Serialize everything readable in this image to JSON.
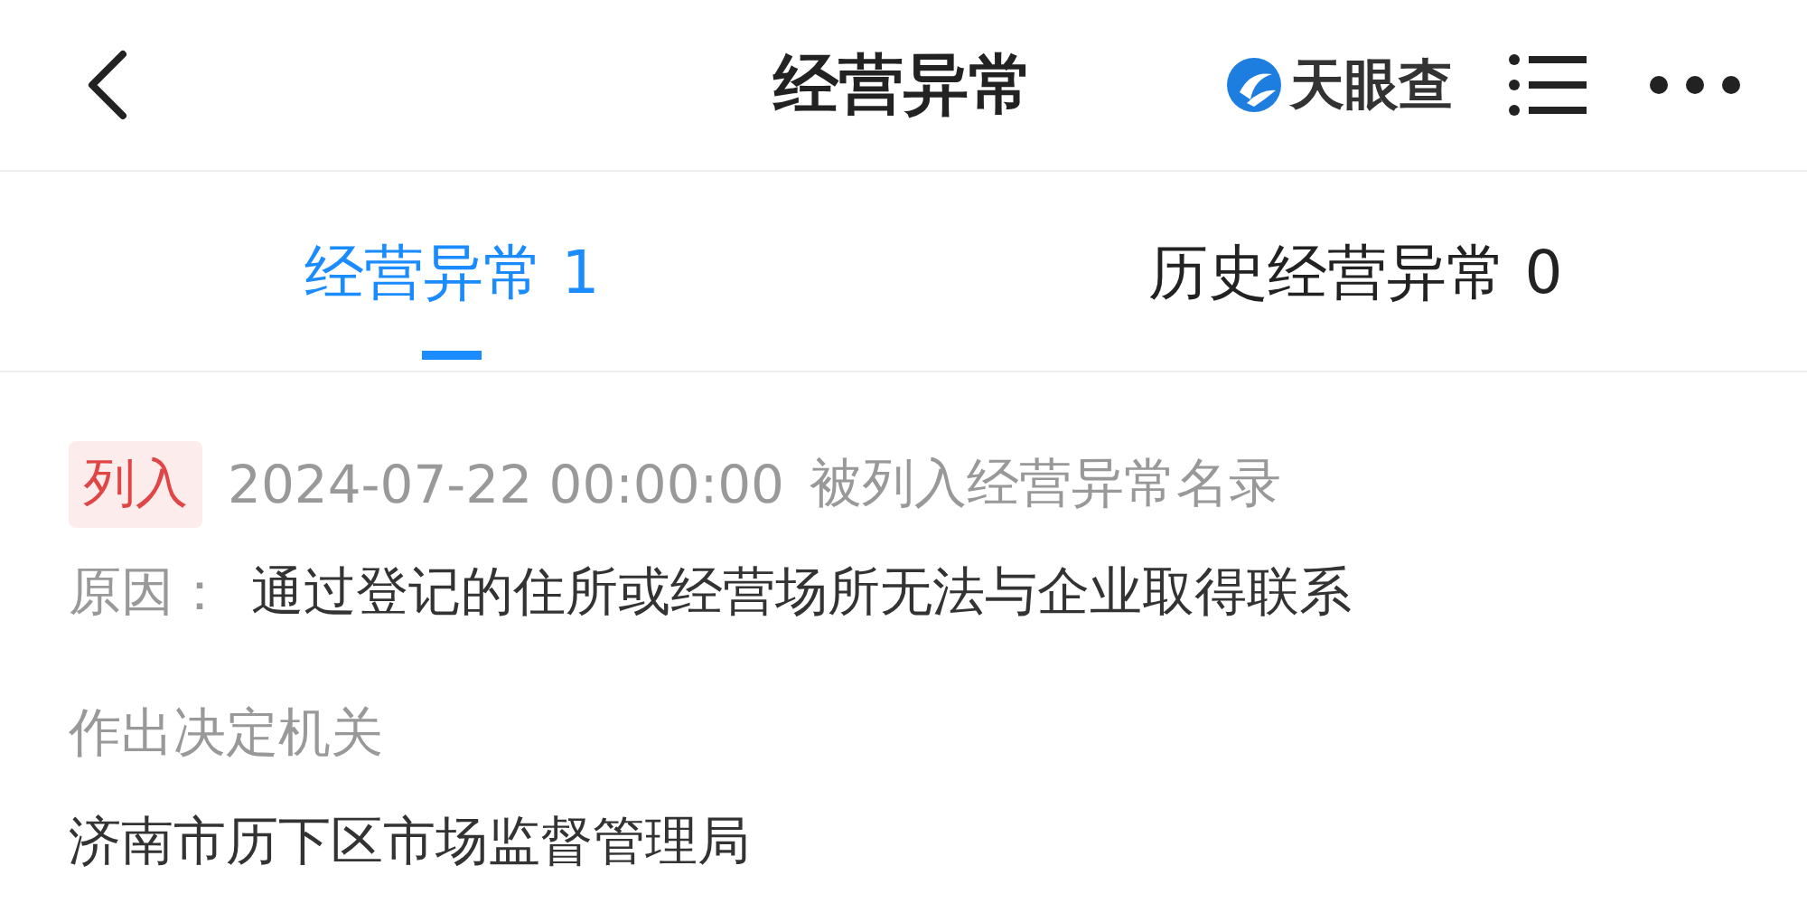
{
  "header": {
    "title": "经营异常",
    "brand": "天眼查"
  },
  "tabs": [
    {
      "label": "经营异常 1",
      "selected": true
    },
    {
      "label": "历史经营异常 0",
      "selected": false
    }
  ],
  "record": {
    "tag": "列入",
    "time": "2024-07-22 00:00:00",
    "event": "被列入经营异常名录",
    "reason_label": "原因：",
    "reason": "通过登记的住所或经营场所无法与企业取得联系",
    "authority_label": "作出决定机关",
    "authority": "济南市历下区市场监督管理局"
  }
}
